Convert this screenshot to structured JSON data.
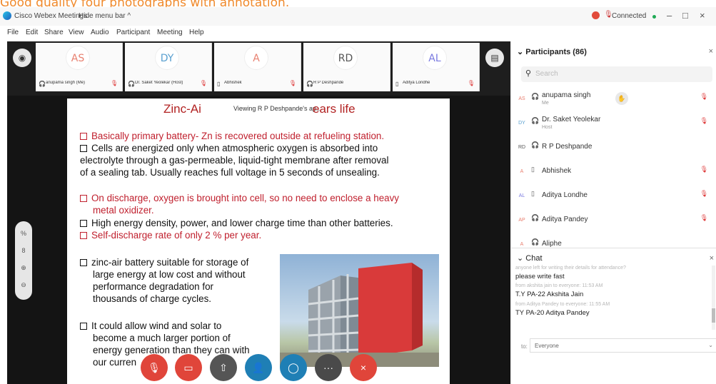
{
  "caption": "Good quality four photographs with annotation.",
  "titlebar": {
    "app_title": "Cisco Webex Meetings",
    "hide_menu": "Hide menu bar ^",
    "status": "Connected",
    "minimize": "–",
    "maximize": "□",
    "close": "×"
  },
  "menu": [
    "File",
    "Edit",
    "Share",
    "View",
    "Audio",
    "Participant",
    "Meeting",
    "Help"
  ],
  "video_strip": [
    {
      "initials": "AS",
      "name": "anupama singh (Me)",
      "color": "#e88070"
    },
    {
      "initials": "DY",
      "name": "Dr. Saket Yeolekar (Host)",
      "color": "#5aa0d0"
    },
    {
      "initials": "A",
      "name": "Abhishek",
      "color": "#e88070"
    },
    {
      "initials": "RD",
      "name": "R P Deshpande",
      "color": "#555555"
    },
    {
      "initials": "AL",
      "name": "Aditya Londhe",
      "color": "#7a7ae0"
    }
  ],
  "slide": {
    "title_left": "Zinc-Ai",
    "title_right": "ears life",
    "share_banner": "Viewing R P Deshpande's ap...",
    "b1": "Basically primary battery-  Zn is recovered outside at refueling station.",
    "b2a": "Cells are energized only when atmospheric oxygen is absorbed into",
    "b2b": "electrolyte through a gas-permeable, liquid-tight membrane after removal",
    "b2c": "of a sealing tab. Usually reaches full voltage in 5 seconds of  unsealing.",
    "b3a": "On discharge, oxygen is brought into cell, so no need to enclose a heavy",
    "b3b": "metal oxidizer.",
    "b4": "High energy density, power, and lower charge time than other batteries.",
    "b5": "Self-discharge rate of only 2 % per year.",
    "b6a": "zinc-air battery suitable for storage of",
    "b6b": "large energy at low cost and without",
    "b6c": "performance        degradation        for",
    "b6d": "thousands of charge cycles.",
    "b7a": "It could allow wind and solar to",
    "b7b": "become a much larger portion of",
    "b7c": "energy generation than they can with",
    "b7d": "our curren"
  },
  "side_tools": [
    "%",
    "8",
    "⊕",
    "⊖"
  ],
  "controls": [
    {
      "name": "mute",
      "icon": "🎙",
      "color": "#e0453a"
    },
    {
      "name": "stop-video",
      "icon": "▭",
      "color": "#e0453a"
    },
    {
      "name": "share",
      "icon": "⇧",
      "color": "#555555"
    },
    {
      "name": "participants",
      "icon": "👤",
      "color": "#1f7fb5"
    },
    {
      "name": "chat",
      "icon": "◯",
      "color": "#1f7fb5"
    },
    {
      "name": "more",
      "icon": "···",
      "color": "#4a4a4a"
    },
    {
      "name": "leave",
      "icon": "×",
      "color": "#e0453a"
    }
  ],
  "participants": {
    "header": "Participants (86)",
    "search_placeholder": "Search",
    "list": [
      {
        "initials": "AS",
        "name": "anupama singh",
        "sub": "Me",
        "color": "#e88070"
      },
      {
        "initials": "DY",
        "name": "Dr. Saket Yeolekar",
        "sub": "Host",
        "color": "#5aa0d0"
      },
      {
        "initials": "RD",
        "name": "R P Deshpande",
        "sub": "",
        "color": "#555555"
      },
      {
        "initials": "A",
        "name": "Abhishek",
        "sub": "",
        "color": "#e88070"
      },
      {
        "initials": "AL",
        "name": "Aditya Londhe",
        "sub": "",
        "color": "#7a7ae0"
      },
      {
        "initials": "AP",
        "name": "Aditya Pandey",
        "sub": "",
        "color": "#e88070"
      },
      {
        "initials": "A",
        "name": "Aliphe",
        "sub": "",
        "color": "#e88070"
      }
    ]
  },
  "chat": {
    "header": "Chat",
    "msg0": "anyone left for writing their details for attendance?",
    "msg1": "please write fast",
    "meta2": "from akshita jain to everyone:    11:53 AM",
    "msg2": "T.Y PA-22 Akshita Jain",
    "meta3": "from Aditya Pandey to everyone:    11:55 AM",
    "msg3": "TY PA-20 Aditya Pandey",
    "to_label": "to:",
    "to_value": "Everyone"
  }
}
